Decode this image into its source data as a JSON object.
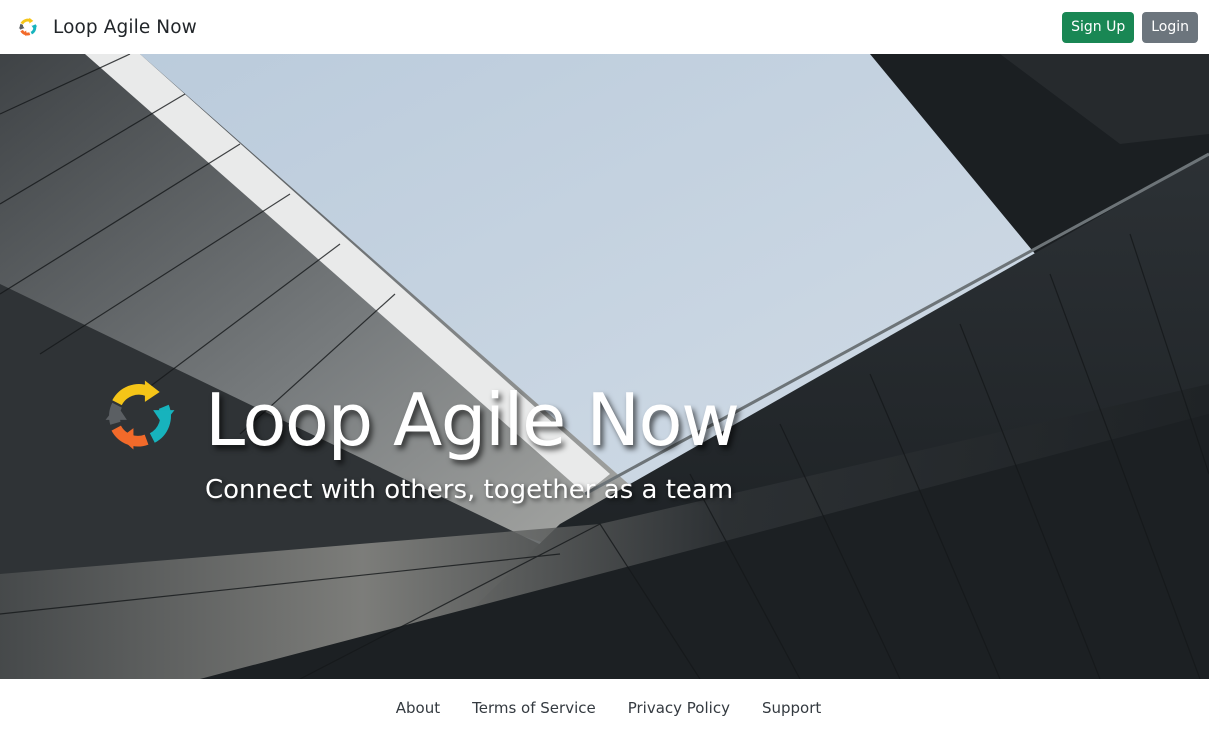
{
  "navbar": {
    "brand_name": "Loop Agile Now",
    "logo_icon": "loop-cycle-icon",
    "signup_label": "Sign Up",
    "login_label": "Login"
  },
  "hero": {
    "background": "architecture-sky-photo",
    "logo_icon": "loop-cycle-icon",
    "title": "Loop Agile Now",
    "subtitle": "Connect with others, together as a team"
  },
  "footer": {
    "links": [
      {
        "label": "About"
      },
      {
        "label": "Terms of Service"
      },
      {
        "label": "Privacy Policy"
      },
      {
        "label": "Support"
      }
    ]
  },
  "colors": {
    "signup_button": "#198754",
    "login_button": "#6c757d",
    "logo_yellow": "#f5c518",
    "logo_teal": "#17b3bd",
    "logo_orange": "#f26a2a",
    "logo_gray": "#5b5f63"
  }
}
